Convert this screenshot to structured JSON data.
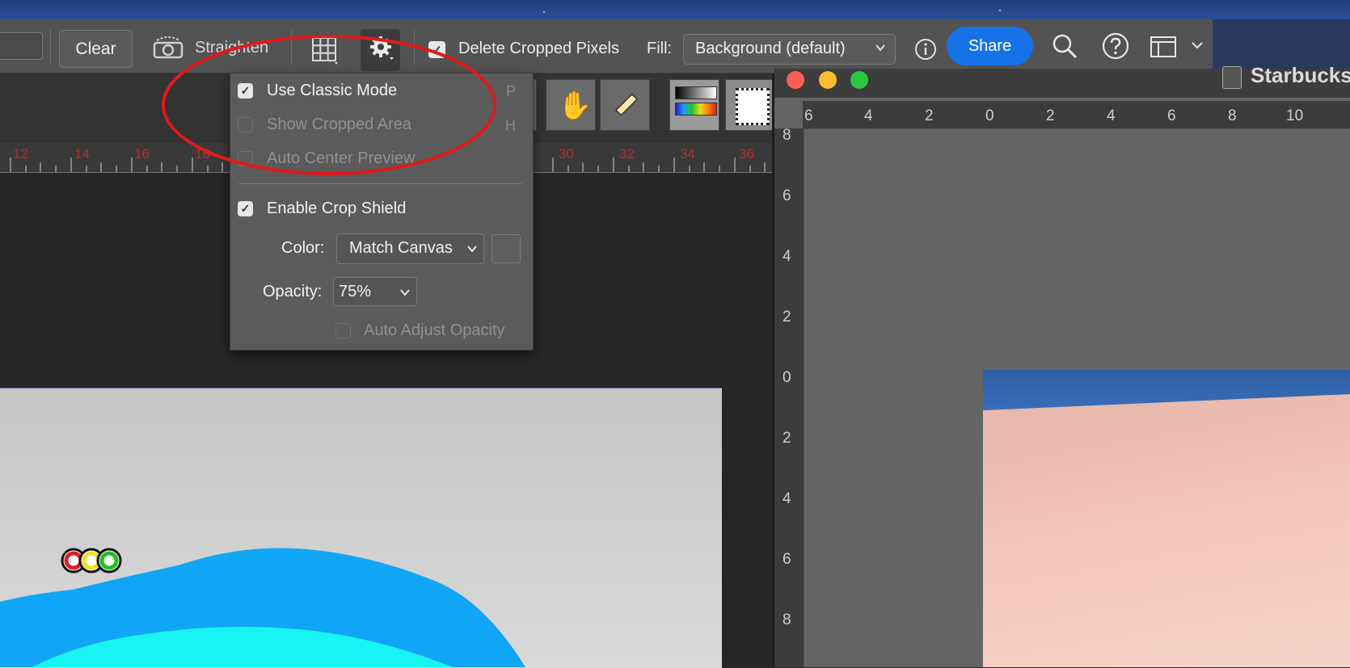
{
  "options_bar": {
    "clear_label": "Clear",
    "straighten_label": "Straighten",
    "delete_cropped_label": "Delete Cropped Pixels",
    "delete_cropped_checked": true,
    "fill_label": "Fill:",
    "fill_value": "Background (default)",
    "share_label": "Share"
  },
  "crop_options_menu": {
    "use_classic_mode": {
      "label": "Use Classic Mode",
      "shortcut": "P",
      "checked": true
    },
    "show_cropped_area": {
      "label": "Show Cropped Area",
      "shortcut": "H",
      "checked": false
    },
    "auto_center_preview": {
      "label": "Auto Center Preview",
      "checked": false
    },
    "enable_crop_shield": {
      "label": "Enable Crop Shield",
      "checked": true
    },
    "color_label": "Color:",
    "color_value": "Match Canvas",
    "opacity_label": "Opacity:",
    "opacity_value": "75%",
    "auto_adjust_opacity": {
      "label": "Auto Adjust Opacity",
      "checked": false
    }
  },
  "left_ruler_ticks": [
    "12",
    "14",
    "16",
    "18",
    "30",
    "32",
    "34",
    "36"
  ],
  "document": {
    "title": "Starbucks",
    "ruler_top": [
      "6",
      "4",
      "2",
      "0",
      "2",
      "4",
      "6",
      "8",
      "10"
    ],
    "ruler_side": [
      "8",
      "6",
      "4",
      "2",
      "0",
      "2",
      "4",
      "6",
      "8"
    ]
  },
  "colors": {
    "accent_share": "#1473e6",
    "annotation_ellipse": "#e01a1a",
    "traffic_close": "#ff5f57",
    "traffic_min": "#febc2e",
    "traffic_max": "#28c840"
  }
}
